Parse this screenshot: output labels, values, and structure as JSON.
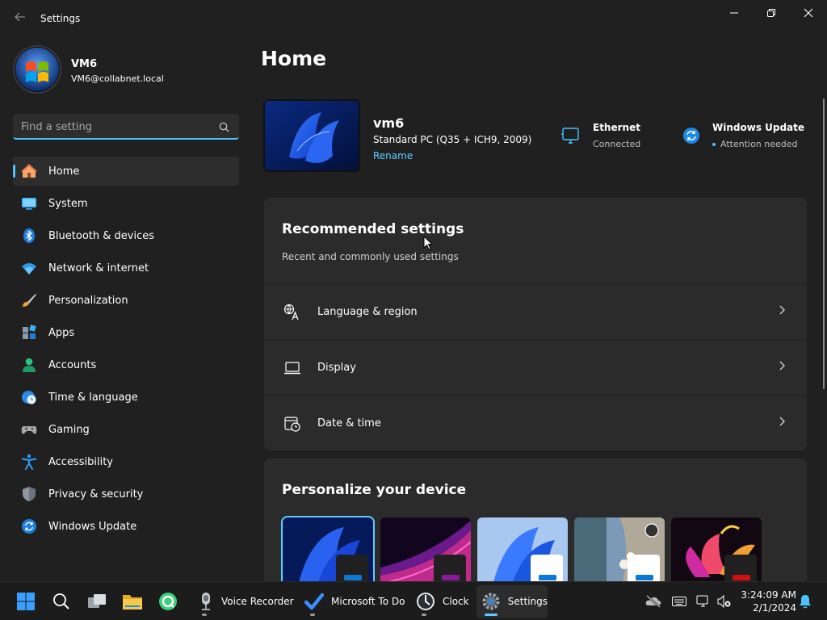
{
  "window": {
    "title": "Settings"
  },
  "profile": {
    "name": "VM6",
    "email": "VM6@collabnet.local"
  },
  "search": {
    "placeholder": "Find a setting"
  },
  "sidebar": {
    "items": [
      {
        "label": "Home",
        "icon": "home-icon",
        "active": true
      },
      {
        "label": "System",
        "icon": "system-icon"
      },
      {
        "label": "Bluetooth & devices",
        "icon": "bluetooth-icon"
      },
      {
        "label": "Network & internet",
        "icon": "wifi-icon"
      },
      {
        "label": "Personalization",
        "icon": "brush-icon"
      },
      {
        "label": "Apps",
        "icon": "apps-icon"
      },
      {
        "label": "Accounts",
        "icon": "person-icon"
      },
      {
        "label": "Time & language",
        "icon": "globe-clock-icon"
      },
      {
        "label": "Gaming",
        "icon": "gamepad-icon"
      },
      {
        "label": "Accessibility",
        "icon": "accessibility-icon"
      },
      {
        "label": "Privacy & security",
        "icon": "shield-icon"
      },
      {
        "label": "Windows Update",
        "icon": "update-icon"
      }
    ]
  },
  "main": {
    "title": "Home",
    "device": {
      "name": "vm6",
      "spec": "Standard PC (Q35 + ICH9, 2009)",
      "rename": "Rename"
    },
    "status": {
      "ethernet": {
        "title": "Ethernet",
        "sub": "Connected"
      },
      "update": {
        "title": "Windows Update",
        "sub": "Attention needed"
      }
    },
    "recommended": {
      "title": "Recommended settings",
      "subtitle": "Recent and commonly used settings",
      "items": [
        {
          "label": "Language & region",
          "icon": "language-icon"
        },
        {
          "label": "Display",
          "icon": "laptop-icon"
        },
        {
          "label": "Date & time",
          "icon": "calendar-clock-icon"
        }
      ]
    },
    "personalize": {
      "title": "Personalize your device"
    }
  },
  "taskbar": {
    "apps": [
      {
        "label": "Voice Recorder"
      },
      {
        "label": "Microsoft To Do"
      },
      {
        "label": "Clock"
      },
      {
        "label": "Settings"
      }
    ],
    "time": "3:24:09 AM",
    "date": "2/1/2024"
  },
  "colors": {
    "accent": "#4cc2ff",
    "link": "#60cdff",
    "background": "#202020",
    "card": "#2b2b2b"
  }
}
